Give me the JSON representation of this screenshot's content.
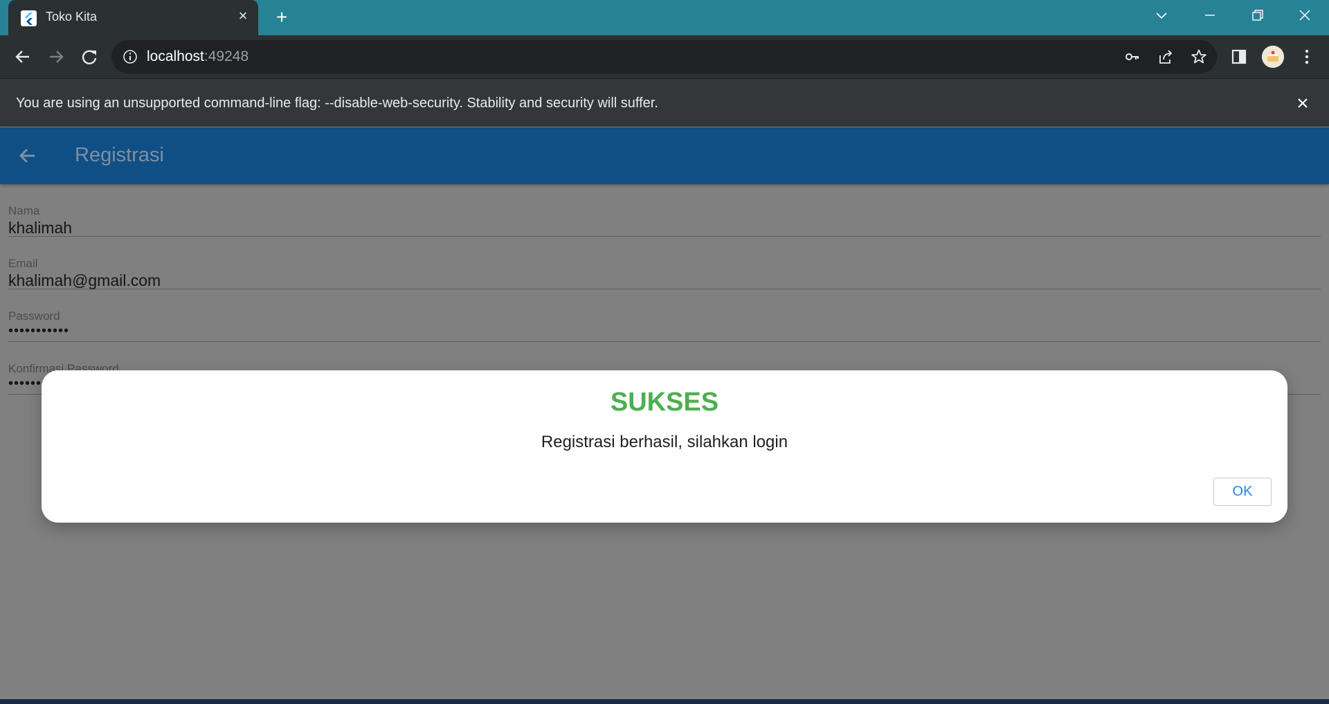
{
  "browser": {
    "tab_title": "Toko Kita",
    "url_host": "localhost",
    "url_port": ":49248",
    "infobar_message": "You are using an unsupported command-line flag: --disable-web-security. Stability and security will suffer."
  },
  "app": {
    "appbar_title": "Registrasi",
    "fields": [
      {
        "label": "Nama",
        "value": "khalimah"
      },
      {
        "label": "Email",
        "value": "khalimah@gmail.com"
      },
      {
        "label": "Password",
        "value": "•••••••••••"
      },
      {
        "label": "Konfirmasi Password",
        "value": "•••••••••••"
      }
    ]
  },
  "dialog": {
    "title": "SUKSES",
    "message": "Registrasi berhasil, silahkan login",
    "ok_label": "OK",
    "title_color": "#4caf50",
    "button_color": "#1e88e5"
  },
  "colors": {
    "tabstrip": "#268294",
    "toolbar": "#2b3033",
    "appbar": "#0f4f86",
    "scrim_background": "#808080"
  },
  "icons": {
    "favicon": "flutter-logo-icon",
    "tab_close": "close-icon",
    "new_tab": "plus-icon",
    "back": "arrow-left-icon",
    "forward": "arrow-right-icon",
    "reload": "reload-icon",
    "site_info": "info-icon",
    "password": "key-icon",
    "share": "share-icon",
    "bookmark": "star-icon",
    "side_panel": "side-panel-icon",
    "menu": "kebab-menu-icon"
  }
}
